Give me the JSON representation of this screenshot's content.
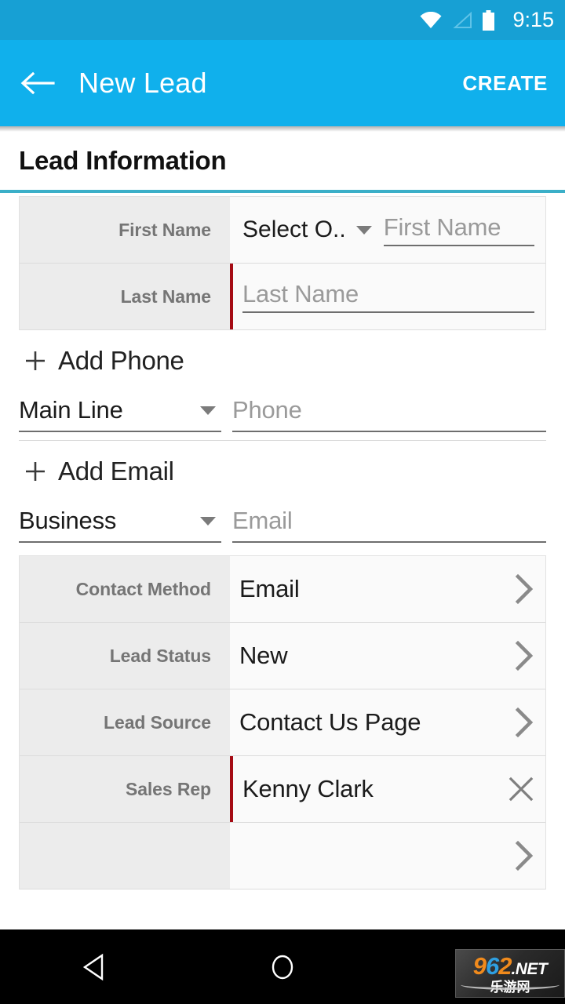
{
  "status_bar": {
    "time": "9:15",
    "icons": [
      "wifi-icon",
      "signal-icon",
      "battery-icon"
    ]
  },
  "app_bar": {
    "back_icon": "arrow-left-icon",
    "title": "New Lead",
    "action_label": "CREATE",
    "background_color": "#10b0ec"
  },
  "section": {
    "title": "Lead Information",
    "underline_color": "#3bafc8"
  },
  "form": {
    "name_group": [
      {
        "label": "First Name",
        "select_value": "Select O..",
        "input_placeholder": "First Name",
        "input_value": "",
        "required": false
      },
      {
        "label": "Last Name",
        "input_placeholder": "Last Name",
        "input_value": "",
        "required": true
      }
    ],
    "add_phone": {
      "label": "Add Phone",
      "type_value": "Main Line",
      "input_placeholder": "Phone",
      "input_value": ""
    },
    "add_email": {
      "label": "Add Email",
      "type_value": "Business",
      "input_placeholder": "Email",
      "input_value": ""
    },
    "detail_group": [
      {
        "label": "Contact Method",
        "value": "Email",
        "accessory": "chevron-right-icon",
        "required": false
      },
      {
        "label": "Lead Status",
        "value": "New",
        "accessory": "chevron-right-icon",
        "required": false
      },
      {
        "label": "Lead Source",
        "value": "Contact Us Page",
        "accessory": "chevron-right-icon",
        "required": false
      },
      {
        "label": "Sales Rep",
        "value": "Kenny Clark",
        "accessory": "clear-x-icon",
        "required": true
      }
    ],
    "required_marker_color": "#a50b14"
  },
  "nav_bar": {
    "back_icon": "nav-back-triangle-icon",
    "home_icon": "nav-home-circle-icon",
    "recents_icon": "nav-recents-square-icon"
  },
  "watermark": {
    "digit_9": "9",
    "digit_6": "6",
    "digit_2": "2",
    "suffix": ".NET",
    "subtitle": "乐游网"
  }
}
